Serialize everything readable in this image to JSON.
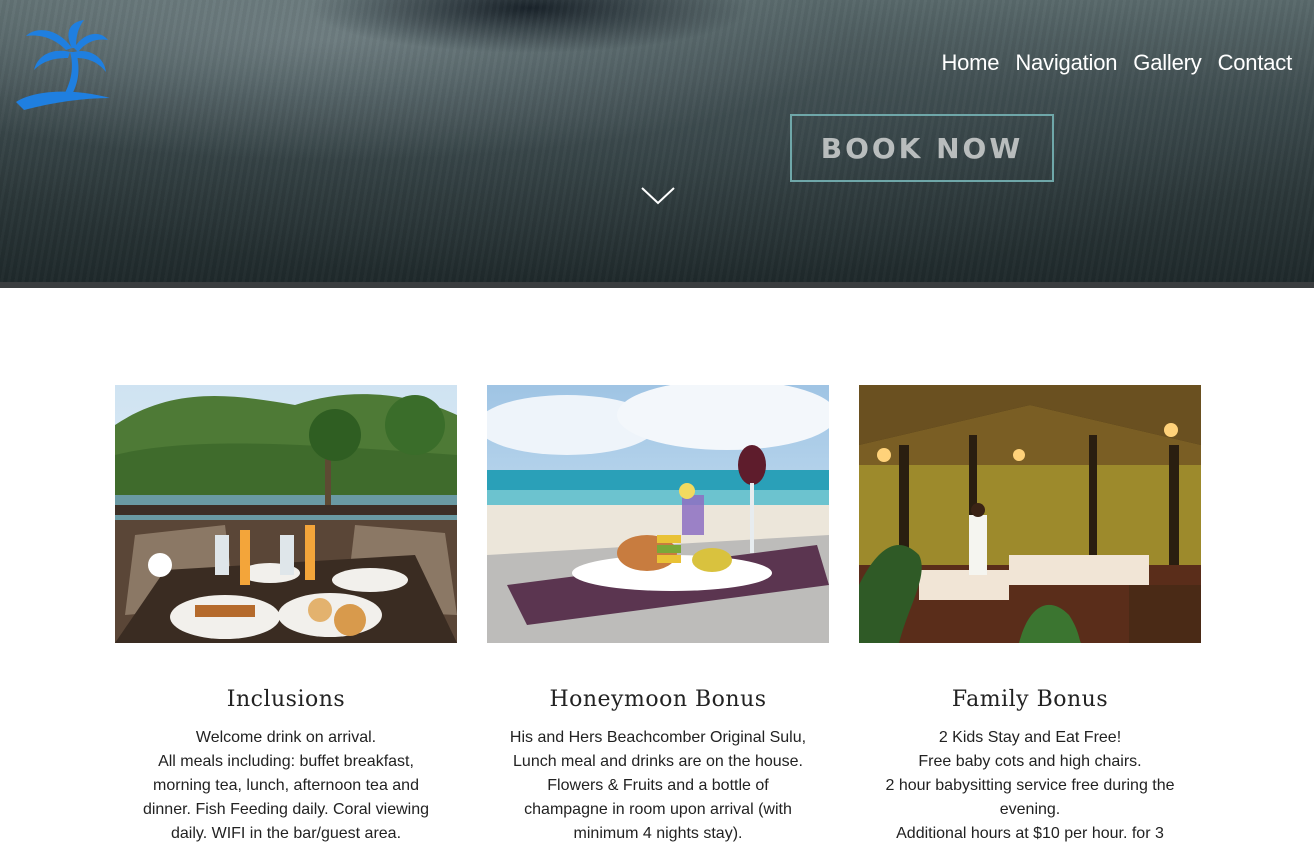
{
  "nav": {
    "items": [
      "Home",
      "Navigation",
      "Gallery",
      "Contact"
    ]
  },
  "hero": {
    "book_label": "BOOK NOW"
  },
  "icons": {
    "logo": "palm-tree-island-logo",
    "scroll": "chevron-down-icon"
  },
  "colors": {
    "logo_blue": "#1f7fe0",
    "button_border": "#6fa7a9"
  },
  "cards": [
    {
      "title": "Inclusions",
      "lines": [
        "Welcome drink on arrival.",
        "All meals including: buffet breakfast, morning tea, lunch, afternoon tea and dinner. Fish Feeding daily. Coral viewing daily. WIFI in the bar/guest area."
      ]
    },
    {
      "title": "Honeymoon Bonus",
      "lines": [
        "His and Hers Beachcomber Original Sulu, Lunch meal and drinks are on the house. Flowers & Fruits and a bottle of champagne in room upon arrival (with minimum 4 nights stay)."
      ]
    },
    {
      "title": "Family Bonus",
      "lines": [
        "2 Kids Stay and Eat Free!",
        "Free baby cots and high chairs.",
        "2 hour babysitting service free during the evening.",
        "Additional hours at $10 per hour. for 3"
      ]
    }
  ]
}
